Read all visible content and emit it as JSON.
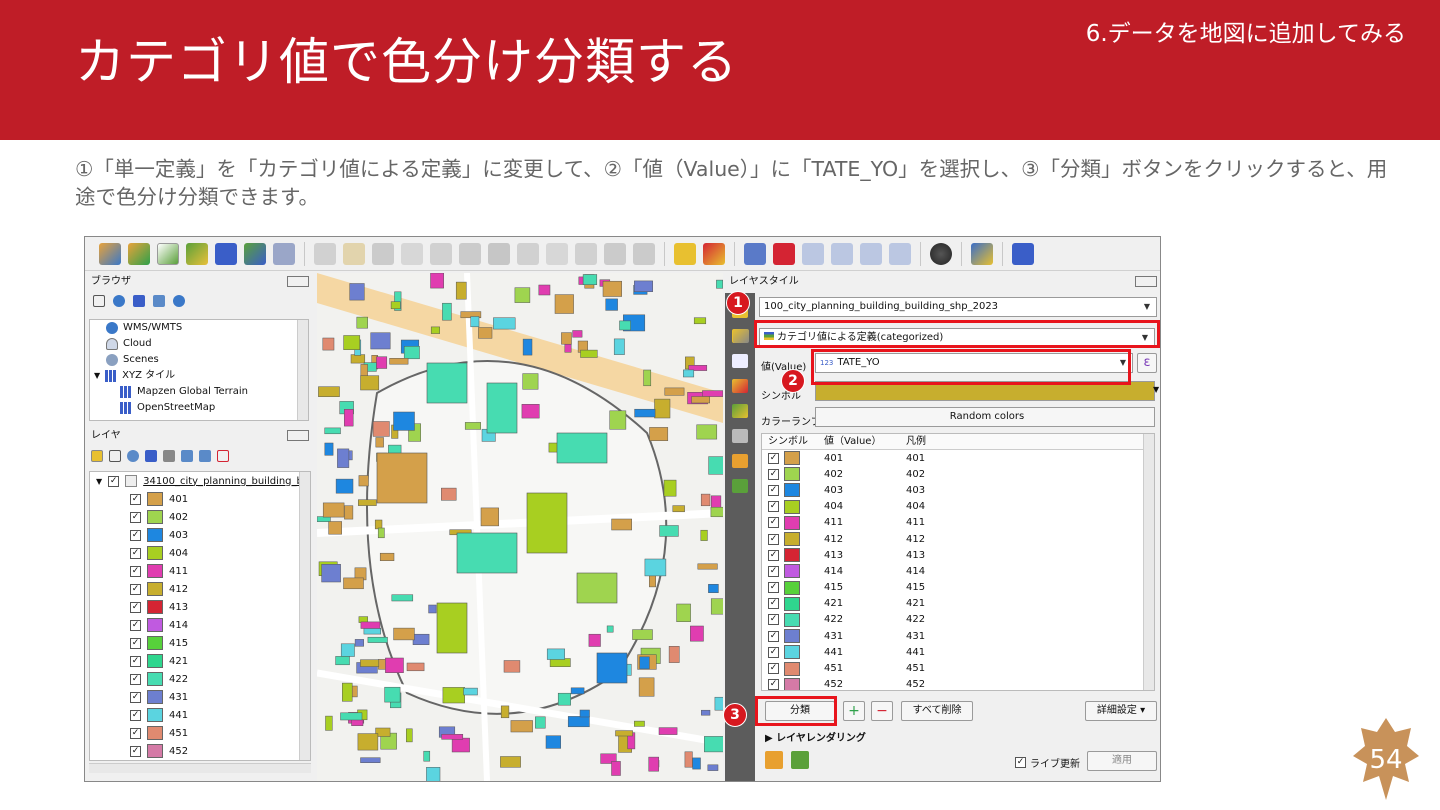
{
  "header": {
    "title": "カテゴリ値で色分け分類する",
    "section": "6.データを地図に追加してみる",
    "bg_color": "#bf1d27"
  },
  "description": "①「単一定義」を「カテゴリ値による定義」に変更して、②「値（Value）」に「TATE_YO」を選択し、③「分類」ボタンをクリックすると、用途で色分け分類できます。",
  "page_number": "54",
  "qgis": {
    "browser": {
      "title": "ブラウザ",
      "items": [
        "WMS/WMTS",
        "Cloud",
        "Scenes",
        "XYZ タイル",
        "Mapzen Global Terrain",
        "OpenStreetMap"
      ]
    },
    "layers": {
      "title": "レイヤ",
      "layer_name": "34100_city_planning_building_b",
      "classes": [
        {
          "value": "401",
          "color": "#d4a04a"
        },
        {
          "value": "402",
          "color": "#9fd44f"
        },
        {
          "value": "403",
          "color": "#1e87e0"
        },
        {
          "value": "404",
          "color": "#a8cf21"
        },
        {
          "value": "411",
          "color": "#e03db0"
        },
        {
          "value": "412",
          "color": "#c7ae2e"
        },
        {
          "value": "413",
          "color": "#d42433"
        },
        {
          "value": "414",
          "color": "#c05ae0"
        },
        {
          "value": "415",
          "color": "#57d13b"
        },
        {
          "value": "421",
          "color": "#2fd68e"
        },
        {
          "value": "422",
          "color": "#47dcb1"
        },
        {
          "value": "431",
          "color": "#6d7fd0"
        },
        {
          "value": "441",
          "color": "#5bd4e0"
        },
        {
          "value": "451",
          "color": "#e08a70"
        },
        {
          "value": "452",
          "color": "#d47aa6"
        }
      ]
    },
    "style_panel": {
      "title": "レイヤスタイル",
      "layer_select": "100_city_planning_building_building_shp_2023",
      "renderer": "カテゴリ値による定義(categorized)",
      "value_label": "値(Value)",
      "value_field": "TATE_YO",
      "value_field_type": "123",
      "symbol_label": "シンボル",
      "ramp_label": "カラーランプ",
      "ramp_value": "Random colors",
      "table_headers": [
        "シンボル",
        "値（Value）",
        "凡例"
      ],
      "classify_button": "分類",
      "delete_all_button": "すべて削除",
      "advanced_button": "詳細設定",
      "layer_rendering": "レイヤレンダリング",
      "live_update": "ライブ更新",
      "apply_button": "適用",
      "epsilon": "ε"
    },
    "callouts": [
      "1",
      "2",
      "3"
    ]
  }
}
